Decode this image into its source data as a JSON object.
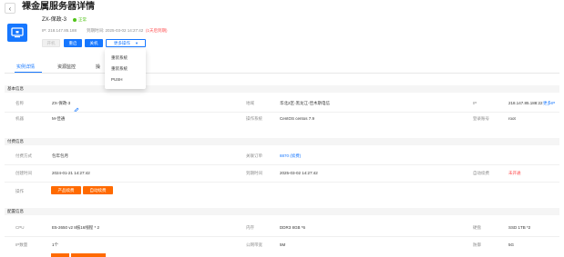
{
  "header": {
    "back_icon": "arrow-left-icon",
    "title": "裸金属服务器详情"
  },
  "server": {
    "icon": "monitor-icon",
    "name": "ZX-保政-3",
    "status": "正常",
    "status_color": "#52c41a",
    "ip_line": "IP: 218.147.85.188",
    "expire_line": "到期时间: 2025-03-02 14:27:42",
    "expire_warning": "(1天后到期)"
  },
  "actions": {
    "disabled_btn": "开机",
    "restart_btn": "重启",
    "shutdown_btn": "关机",
    "more_btn": "更多操作",
    "more_caret": "▾"
  },
  "dropdown": {
    "items": [
      "重装系统",
      "重装系统",
      "PUSH"
    ]
  },
  "tabs": [
    "实例详情",
    "资源监控",
    "操"
  ],
  "basic": {
    "section_title": "基本信息",
    "name_label": "名称",
    "name_value": "ZX-保政-3",
    "edit_icon": "edit-icon",
    "region_label": "地域",
    "region_value": "华北2区-黑龙江-佳木斯电信",
    "ip_label": "IP",
    "ip_value": "218.147.85.188:22",
    "ip_more": "更多IP",
    "group_label": "机器",
    "group_value": "M-佳通",
    "os_label": "操作系统",
    "os_value": "CentOS centos 7.9",
    "account_label": "登录账号",
    "account_value": "root"
  },
  "billing": {
    "section_title": "付费信息",
    "pay_label": "付费方式",
    "pay_value": "包年包月",
    "order_label": "关联订单",
    "order_value": "8870 (续费)",
    "create_label": "创建时间",
    "create_value": "2024-01-21 14:27:42",
    "expire_label": "到期时间",
    "expire_value": "2025-03-02 14:27:42",
    "autorenew_label": "自动续费",
    "autorenew_value": "未开通",
    "op_label": "操作",
    "btn_renew": "产品续费",
    "btn_auto": "自动续费"
  },
  "config": {
    "section_title": "配置信息",
    "cpu_label": "CPU",
    "cpu_value": "E5-2650 v2 8核16线程 * 2",
    "mem_label": "内存",
    "mem_value": "DDR3 8GB *6",
    "disk_label": "硬盘",
    "disk_value": "SSD 1TB *2",
    "ipcount_label": "IP数量",
    "ipcount_value": "1个",
    "bw_label": "公网带宽",
    "bw_value": "5M",
    "defense_label": "防御",
    "defense_value": "5G"
  }
}
